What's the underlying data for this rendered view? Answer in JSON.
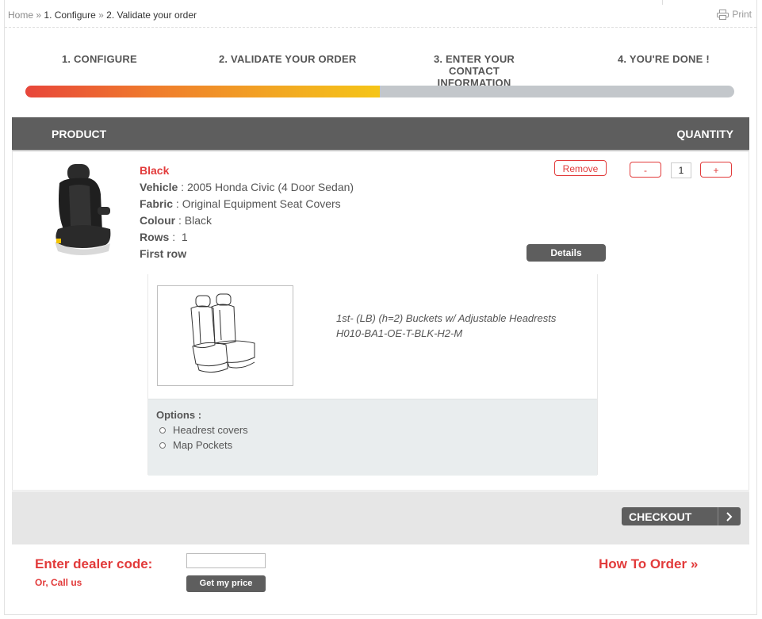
{
  "breadcrumb": {
    "home": "Home",
    "separator": "»",
    "step1": "1. Configure",
    "step2": "2. Validate your order"
  },
  "print_label": "Print",
  "steps": [
    {
      "label": "1. CONFIGURE"
    },
    {
      "label": "2. VALIDATE YOUR ORDER"
    },
    {
      "label": "3. ENTER YOUR CONTACT\nINFORMATION"
    },
    {
      "label": "4. YOU'RE DONE !"
    }
  ],
  "progress": {
    "fraction": 0.5
  },
  "table": {
    "product_header": "PRODUCT",
    "quantity_header": "QUANTITY"
  },
  "item": {
    "title": "Black",
    "fields": [
      {
        "label": "Vehicle",
        "sep": " : ",
        "value": "2005 Honda Civic (4 Door Sedan)"
      },
      {
        "label": "Fabric",
        "sep": " : ",
        "value": "Original Equipment Seat Covers"
      },
      {
        "label": "Colour",
        "sep": " : ",
        "value": "Black"
      },
      {
        "label": "Rows",
        "sep": " :  ",
        "value": "1"
      }
    ],
    "row_name": "First row",
    "remove_label": "Remove",
    "decrement_label": "-",
    "quantity": "1",
    "increment_label": "+",
    "details_label": "Details",
    "desc_line1": "1st- (LB) (h=2) Buckets w/ Adjustable Headrests",
    "desc_line2": "H010-BA1-OE-T-BLK-H2-M",
    "options_label": "Options :",
    "options": [
      "Headrest covers",
      "Map Pockets"
    ]
  },
  "checkout_label": "CHECKOUT",
  "dealer": {
    "label": "Enter dealer code:",
    "call_us": "Or, Call us",
    "input_value": "",
    "button_label": "Get my price"
  },
  "how_to_order": "How To Order  »",
  "colors": {
    "accent_red": "#e23b3b",
    "header_gray": "#5e5e5e",
    "progress_start": "#e8463a",
    "progress_end": "#f5c518"
  }
}
